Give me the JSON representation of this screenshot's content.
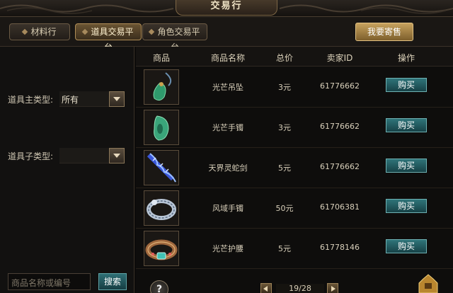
{
  "window": {
    "title": "交易行"
  },
  "tabs": [
    {
      "label": "材料行",
      "active": false
    },
    {
      "label": "道具交易平台",
      "active": true
    },
    {
      "label": "角色交易平台",
      "active": false
    }
  ],
  "actions": {
    "sell_label": "我要寄售"
  },
  "filters": {
    "main_type_label": "道具主类型:",
    "main_type_value": "所有",
    "sub_type_label": "道具子类型:",
    "sub_type_value": ""
  },
  "search": {
    "placeholder": "商品名称或编号",
    "button_label": "搜索"
  },
  "table": {
    "headers": [
      "商品",
      "商品名称",
      "总价",
      "卖家ID",
      "操作"
    ],
    "rows": [
      {
        "icon": "jade-pendant-icon",
        "name": "光芒吊坠",
        "price": "3元",
        "seller": "61776662",
        "action": "购买"
      },
      {
        "icon": "jade-bracelet-icon",
        "name": "光芒手镯",
        "price": "3元",
        "seller": "61776662",
        "action": "购买"
      },
      {
        "icon": "blue-snake-sword-icon",
        "name": "天界灵蛇剑",
        "price": "5元",
        "seller": "61776662",
        "action": "购买"
      },
      {
        "icon": "silver-bracelet-icon",
        "name": "风域手镯",
        "price": "50元",
        "seller": "61706381",
        "action": "购买"
      },
      {
        "icon": "jeweled-belt-icon",
        "name": "光芒护腰",
        "price": "5元",
        "seller": "61778146",
        "action": "购买"
      }
    ]
  },
  "pagination": {
    "text": "19/28"
  },
  "colors": {
    "accent_gold": "#c7a25e",
    "buy_teal": "#2f7479",
    "background": "#0c0b0a"
  }
}
